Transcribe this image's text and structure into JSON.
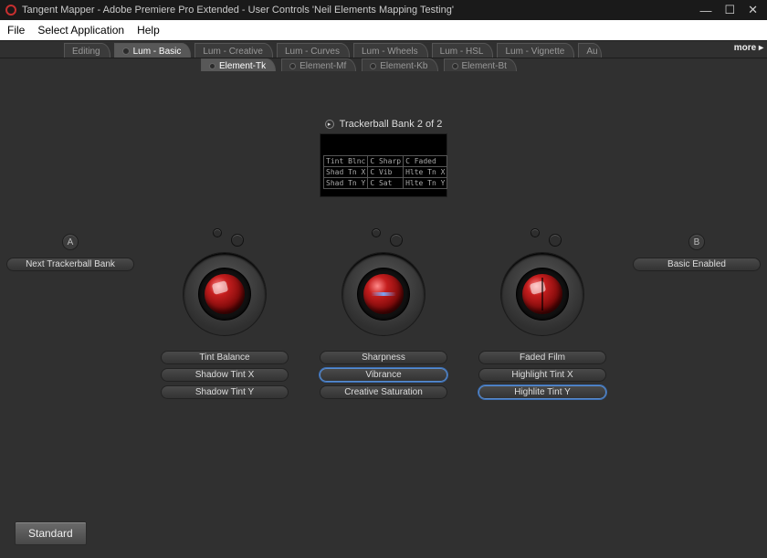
{
  "title": "Tangent Mapper - Adobe Premiere Pro Extended - User Controls 'Neil Elements Mapping Testing'",
  "menu": {
    "file": "File",
    "select_app": "Select Application",
    "help": "Help"
  },
  "tabs": {
    "items": [
      "Editing",
      "Lum - Basic",
      "Lum - Creative",
      "Lum - Curves",
      "Lum - Wheels",
      "Lum - HSL",
      "Lum - Vignette",
      "Au"
    ],
    "more": "more ▸"
  },
  "subtabs": {
    "items": [
      "Element-Tk",
      "Element-Mf",
      "Element-Kb",
      "Element-Bt"
    ]
  },
  "bank_label": "Trackerball Bank 2 of 2",
  "lcd": {
    "rows": [
      [
        "Tint Blnc",
        "C Sharp",
        "C Faded"
      ],
      [
        "Shad Tn X",
        "C Vib",
        "Hlte Tn X"
      ],
      [
        "Shad Tn Y",
        "C Sat",
        "Hlte Tn Y"
      ]
    ]
  },
  "side": {
    "a": "A",
    "b": "B",
    "a_label": "Next Trackerball Bank",
    "b_label": "Basic Enabled"
  },
  "balls": [
    {
      "labels": [
        "Tint Balance",
        "Shadow Tint X",
        "Shadow Tint Y"
      ],
      "selected": -1,
      "style": "hl"
    },
    {
      "labels": [
        "Sharpness",
        "Vibrance",
        "Creative Saturation"
      ],
      "selected": 1,
      "style": "arrow"
    },
    {
      "labels": [
        "Faded Film",
        "Highlight Tint X",
        "Highlite Tint Y"
      ],
      "selected": 2,
      "style": "split"
    }
  ],
  "footer": {
    "standard": "Standard"
  }
}
